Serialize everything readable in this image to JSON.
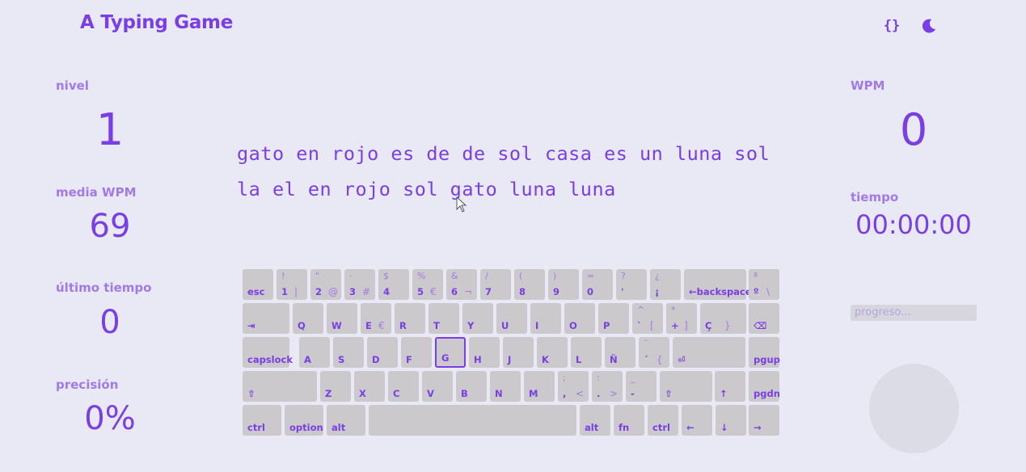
{
  "app": {
    "title": "A Typing Game"
  },
  "header": {
    "code_icon": "code-braces-icon",
    "theme_icon": "moon-icon"
  },
  "left_stats": [
    {
      "label": "nivel",
      "value": "1"
    },
    {
      "label": "media WPM",
      "value": "69"
    },
    {
      "label": "último tiempo",
      "value": "0"
    },
    {
      "label": "precisión",
      "value": "0%"
    }
  ],
  "right_stats": {
    "wpm": {
      "label": "WPM",
      "value": "0"
    },
    "time": {
      "label": "tiempo",
      "value": "00:00:00"
    },
    "progress_placeholder": "progreso..."
  },
  "text": {
    "line1": "gato en rojo es de de sol casa es un luna sol",
    "line2": "la el en rojo sol gato luna luna"
  },
  "keyboard": {
    "highlighted_key": "G",
    "rows": [
      [
        {
          "bot": "esc"
        },
        {
          "top": "!",
          "bot": "1",
          "alt": "|"
        },
        {
          "top": "\"",
          "bot": "2",
          "alt": "@"
        },
        {
          "top": "·",
          "bot": "3",
          "alt": "#"
        },
        {
          "top": "$",
          "bot": "4"
        },
        {
          "top": "%",
          "bot": "5",
          "alt": "€"
        },
        {
          "top": "&",
          "bot": "6",
          "alt": "¬"
        },
        {
          "top": "/",
          "bot": "7"
        },
        {
          "top": "(",
          "bot": "8"
        },
        {
          "top": ")",
          "bot": "9"
        },
        {
          "top": "=",
          "bot": "0"
        },
        {
          "top": "?",
          "bot": "'"
        },
        {
          "top": "¿",
          "bot": "¡"
        },
        {
          "bot": "←backspace"
        },
        {
          "top": "ª",
          "bot": "º",
          "alt": "\\"
        }
      ],
      [
        {
          "bot": "⇥"
        },
        {
          "bot": "Q"
        },
        {
          "bot": "W"
        },
        {
          "bot": "E",
          "alt": "€"
        },
        {
          "bot": "R"
        },
        {
          "bot": "T"
        },
        {
          "bot": "Y"
        },
        {
          "bot": "U"
        },
        {
          "bot": "I"
        },
        {
          "bot": "O"
        },
        {
          "bot": "P"
        },
        {
          "top": "^",
          "bot": "`",
          "alt": "["
        },
        {
          "top": "*",
          "bot": "+",
          "alt": "]"
        },
        {
          "bot": "Ç",
          "alt": "}"
        },
        {
          "bot": "⌫"
        }
      ],
      [
        {
          "bot": "capslock"
        },
        {
          "bot": "A"
        },
        {
          "bot": "S"
        },
        {
          "bot": "D"
        },
        {
          "bot": "F"
        },
        {
          "bot": "G"
        },
        {
          "bot": "H"
        },
        {
          "bot": "J"
        },
        {
          "bot": "K"
        },
        {
          "bot": "L"
        },
        {
          "bot": "Ñ"
        },
        {
          "top": "¨",
          "bot": "´",
          "alt": "{"
        },
        {
          "bot": "⏎"
        },
        {
          "bot": "pgup"
        }
      ],
      [
        {
          "bot": "⇧"
        },
        {
          "bot": "Z"
        },
        {
          "bot": "X"
        },
        {
          "bot": "C"
        },
        {
          "bot": "V"
        },
        {
          "bot": "B"
        },
        {
          "bot": "N"
        },
        {
          "bot": "M"
        },
        {
          "top": ";",
          "bot": ",",
          "alt": "<"
        },
        {
          "top": ":",
          "bot": ".",
          "alt": ">"
        },
        {
          "top": "_",
          "bot": "-"
        },
        {
          "bot": "⇧"
        },
        {
          "bot": "↑"
        },
        {
          "bot": "pgdn"
        }
      ],
      [
        {
          "bot": "ctrl"
        },
        {
          "bot": "option"
        },
        {
          "bot": "alt"
        },
        {
          "bot": ""
        },
        {
          "bot": "alt"
        },
        {
          "bot": "fn"
        },
        {
          "bot": "ctrl"
        },
        {
          "bot": "←"
        },
        {
          "bot": "↓"
        },
        {
          "bot": "→"
        }
      ]
    ]
  }
}
